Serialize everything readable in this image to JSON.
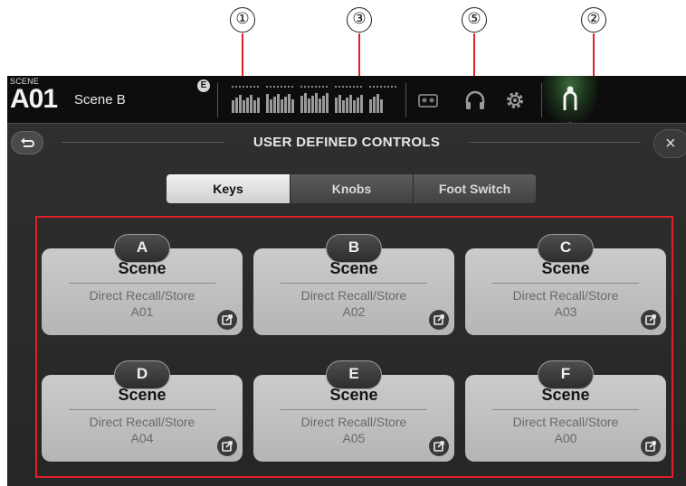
{
  "callouts": [
    {
      "label": "①",
      "target": "Keys tab"
    },
    {
      "label": "③",
      "target": "Knobs tab"
    },
    {
      "label": "⑤",
      "target": "Foot Switch tab"
    },
    {
      "label": "②",
      "target": "Key grid"
    }
  ],
  "topbar": {
    "scene_label": "SCENE",
    "scene_number": "A01",
    "scene_name": "Scene B",
    "badge": "E",
    "icons": [
      "recorder-icon",
      "headphones-icon",
      "gear-icon",
      "user-icon"
    ],
    "active_icon": "user-icon",
    "active_glow_color": "#3b6b3b"
  },
  "panel": {
    "title": "USER DEFINED CONTROLS",
    "back_icon": "back-arrow-icon",
    "close_label": "×"
  },
  "tabs": [
    {
      "label": "Keys",
      "selected": true
    },
    {
      "label": "Knobs",
      "selected": false
    },
    {
      "label": "Foot Switch",
      "selected": false
    }
  ],
  "keys": [
    {
      "letter": "A",
      "title": "Scene",
      "function": "Direct Recall/Store",
      "value": "A01"
    },
    {
      "letter": "B",
      "title": "Scene",
      "function": "Direct Recall/Store",
      "value": "A02"
    },
    {
      "letter": "C",
      "title": "Scene",
      "function": "Direct Recall/Store",
      "value": "A03"
    },
    {
      "letter": "D",
      "title": "Scene",
      "function": "Direct Recall/Store",
      "value": "A04"
    },
    {
      "letter": "E",
      "title": "Scene",
      "function": "Direct Recall/Store",
      "value": "A05"
    },
    {
      "letter": "F",
      "title": "Scene",
      "function": "Direct Recall/Store",
      "value": "A00"
    }
  ],
  "colors": {
    "highlight": "#e0202a",
    "screen_bg": "#1c1c1c",
    "card_bg": "#c4c4c4"
  }
}
